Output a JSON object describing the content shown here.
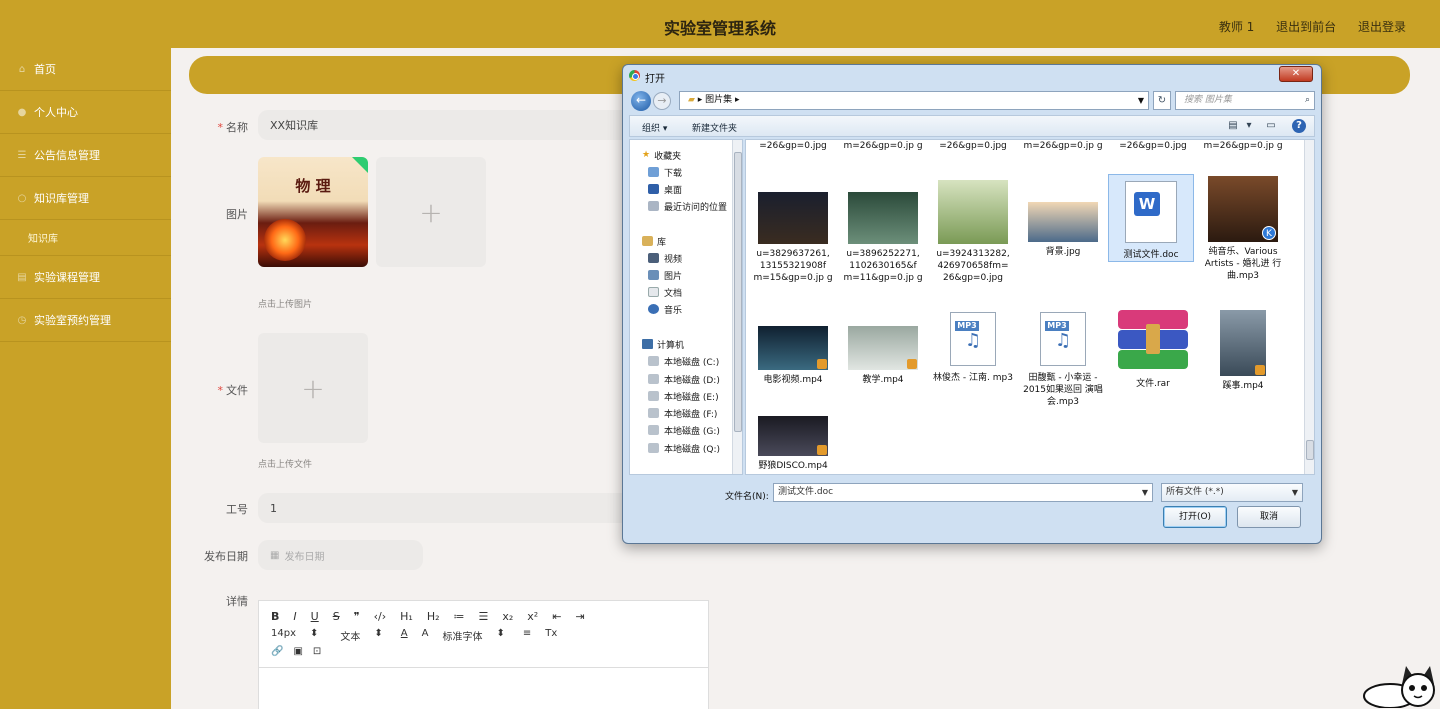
{
  "app": {
    "title": "实验室管理系统",
    "header_links": [
      "教师 1",
      "退出到前台",
      "退出登录"
    ]
  },
  "sidebar": {
    "items": [
      {
        "label": "首页",
        "icon": "home-icon"
      },
      {
        "label": "个人中心",
        "icon": "user-icon"
      },
      {
        "label": "公告信息管理",
        "icon": "list-icon"
      },
      {
        "label": "知识库管理",
        "icon": "book-icon"
      }
    ],
    "subitem": "知识库",
    "items2": [
      {
        "label": "实验课程管理",
        "icon": "course-icon"
      },
      {
        "label": "实验室预约管理",
        "icon": "calendar-icon"
      }
    ]
  },
  "form": {
    "name_label": "名称",
    "name_value": "XX知识库",
    "image_label": "图片",
    "cover_text": "物 理",
    "image_hint": "点击上传图片",
    "file_label": "文件",
    "file_hint": "点击上传文件",
    "job_label": "工号",
    "job_value": "1",
    "date_label": "发布日期",
    "date_placeholder": "发布日期",
    "detail_label": "详情",
    "editor_row1": [
      "B",
      "I",
      "U",
      "S",
      "❞",
      "‹/›",
      "H₁",
      "H₂",
      "≔",
      "☰",
      "x₂",
      "x²",
      "⇤",
      "⇥"
    ],
    "editor_row2": [
      "14px",
      "⬍",
      "文本",
      "⬍",
      "A",
      "A",
      "标准字体",
      "⬍",
      "≡",
      "Tx"
    ],
    "editor_row3": [
      "🔗",
      "▣",
      "⊡"
    ]
  },
  "dialog": {
    "title": "打开",
    "close": "✕",
    "address": "▸ 图片集 ▸",
    "search_placeholder": "搜索 图片集",
    "organize": "组织 ▾",
    "new_folder": "新建文件夹",
    "nav": {
      "favorites": "收藏夹",
      "fav_items": [
        "下载",
        "桌面",
        "最近访问的位置"
      ],
      "library": "库",
      "lib_items": [
        "视频",
        "图片",
        "文档",
        "音乐"
      ],
      "computer": "计算机",
      "drives": [
        "本地磁盘 (C:)",
        "本地磁盘 (D:)",
        "本地磁盘 (E:)",
        "本地磁盘 (F:)",
        "本地磁盘 (G:)",
        "本地磁盘 (Q:)"
      ]
    },
    "top_row": [
      "=26&gp=0.jpg",
      "m=26&gp=0.jp g",
      "=26&gp=0.jpg",
      "m=26&gp=0.jp g",
      "=26&gp=0.jpg",
      "m=26&gp=0.jp g"
    ],
    "files": [
      {
        "name": "u=3829637261, 13155321908f m=15&gp=0.jp g"
      },
      {
        "name": "u=3896252271, 1102630165&f m=11&gp=0.jp g"
      },
      {
        "name": "u=3924313282, 426970658fm= 26&gp=0.jpg"
      },
      {
        "name": "背景.jpg"
      },
      {
        "name": "测试文件.doc"
      },
      {
        "name": "纯音乐、Various Artists - 婚礼进 行曲.mp3"
      },
      {
        "name": "电影视频.mp4"
      },
      {
        "name": "教学.mp4"
      },
      {
        "name": "林俊杰 - 江南. mp3"
      },
      {
        "name": "田馥甄 - 小幸运 - 2015如果巡回 演唱会.mp3"
      },
      {
        "name": "文件.rar"
      },
      {
        "name": "蹊事.mp4"
      },
      {
        "name": "野狼DISCO.mp4"
      }
    ],
    "filename_label": "文件名(N):",
    "filename_value": "测试文件.doc",
    "filetype": "所有文件 (*.*)",
    "open_btn": "打开(O)",
    "cancel_btn": "取消"
  }
}
